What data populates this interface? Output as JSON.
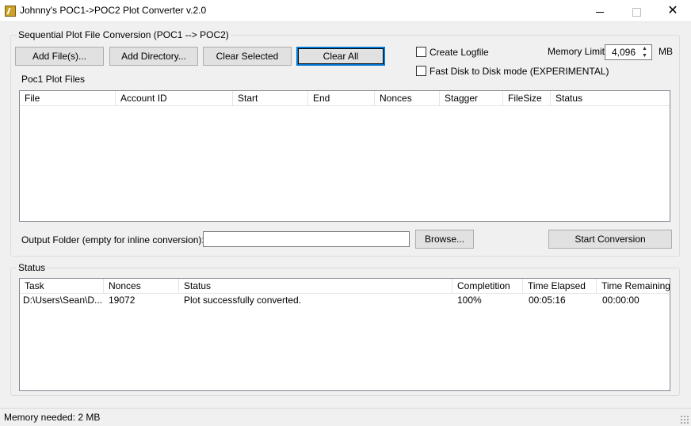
{
  "window": {
    "title": "Johnny's POC1->POC2 Plot Converter v.2.0",
    "controls": {
      "minimize": "—",
      "maximize": "",
      "close": "✕"
    }
  },
  "conversion_group": {
    "legend": "Sequential Plot File Conversion (POC1 --> POC2)",
    "buttons": {
      "add_files": "Add File(s)...",
      "add_directory": "Add Directory...",
      "clear_selected": "Clear Selected",
      "clear_all": "Clear All"
    },
    "create_logfile": {
      "label": "Create Logfile",
      "checked": false
    },
    "fast_disk": {
      "label": "Fast Disk to Disk mode (EXPERIMENTAL)",
      "checked": false
    },
    "memory_limit": {
      "label": "Memory Limit",
      "value": "4,096",
      "unit": "MB"
    },
    "plot_files_label": "Poc1 Plot Files",
    "plot_columns": [
      "File",
      "Account ID",
      "Start",
      "End",
      "Nonces",
      "Stagger",
      "FileSize",
      "Status"
    ],
    "plot_rows": [],
    "output_folder": {
      "label": "Output Folder (empty for inline conversion):",
      "value": "",
      "placeholder": ""
    },
    "browse_button": "Browse...",
    "start_button": "Start Conversion"
  },
  "status_group": {
    "legend": "Status",
    "columns": [
      "Task",
      "Nonces",
      "Status",
      "Completition",
      "Time Elapsed",
      "Time Remaining"
    ],
    "rows": [
      {
        "task": "D:\\Users\\Sean\\D...",
        "nonces": "19072",
        "status": "Plot successfully converted.",
        "completion": "100%",
        "elapsed": "00:05:16",
        "remaining": "00:00:00"
      }
    ]
  },
  "statusbar": {
    "text": "Memory needed: 2 MB"
  }
}
